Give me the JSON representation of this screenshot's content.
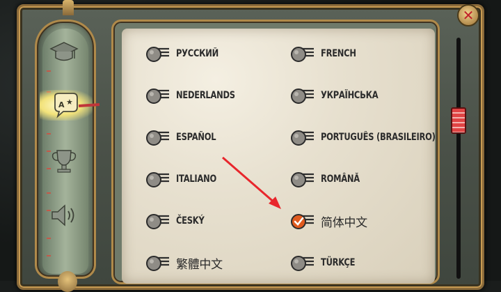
{
  "colors": {
    "accent_red": "#e0303a",
    "check_orange": "#e05a1e",
    "ink": "#2b2b2b",
    "brass": "#b08a4a"
  },
  "close_button": {
    "icon": "close-icon"
  },
  "sidebar": {
    "items": [
      {
        "icon": "graduation-cap-icon",
        "active": false
      },
      {
        "icon": "language-speech-bubble-icon",
        "active": true
      },
      {
        "icon": "trophy-icon",
        "active": false
      },
      {
        "icon": "speaker-volume-icon",
        "active": false
      }
    ]
  },
  "languages": {
    "left": [
      {
        "label": "РУССКИЙ",
        "selected": false
      },
      {
        "label": "NEDERLANDS",
        "selected": false
      },
      {
        "label": "ESPAÑOL",
        "selected": false
      },
      {
        "label": "ITALIANO",
        "selected": false
      },
      {
        "label": "ČESKÝ",
        "selected": false
      },
      {
        "label": "繁體中文",
        "selected": false
      }
    ],
    "right": [
      {
        "label": "FRENCH",
        "selected": false
      },
      {
        "label": "УКРАЇНСЬКА",
        "selected": false
      },
      {
        "label": "PORTUGUÊS (BRASILEIRO)",
        "selected": false
      },
      {
        "label": "ROMÂNĂ",
        "selected": false
      },
      {
        "label": "简体中文",
        "selected": true
      },
      {
        "label": "TÜRKÇE",
        "selected": false
      }
    ]
  }
}
